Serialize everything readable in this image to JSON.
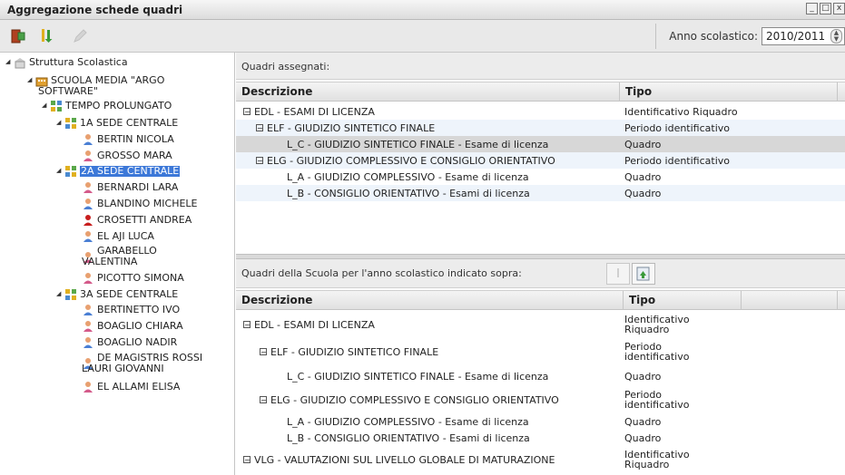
{
  "window": {
    "title": "Aggregazione schede quadri"
  },
  "toolbar": {
    "buttons": [
      {
        "name": "exit-icon"
      },
      {
        "name": "sort-icon"
      },
      {
        "name": "edit-icon"
      }
    ],
    "anno_label": "Anno scolastico:",
    "anno_value": "2010/2011"
  },
  "tree": {
    "root": "Struttura Scolastica",
    "school_line1": "SCUOLA MEDIA \"ARGO",
    "school_line2": "SOFTWARE\"",
    "tempo": "TEMPO PROLUNGATO",
    "class_1a": "1A SEDE CENTRALE",
    "s_1a": [
      "BERTIN NICOLA",
      "GROSSO MARA"
    ],
    "class_2a": "2A SEDE CENTRALE",
    "s_2a": [
      "BERNARDI LARA",
      "BLANDINO MICHELE",
      "CROSETTI ANDREA",
      "EL AJI LUCA"
    ],
    "s_2a_garabello_1": "GARABELLO",
    "s_2a_garabello_2": "VALENTINA",
    "s_2a_last": "PICOTTO SIMONA",
    "class_3a": "3A SEDE CENTRALE",
    "s_3a": [
      "BERTINETTO IVO",
      "BOAGLIO CHIARA",
      "BOAGLIO NADIR"
    ],
    "s_3a_dm_1": "DE MAGISTRIS ROSSI",
    "s_3a_dm_2": "LAURI GIOVANNI",
    "s_3a_last": "EL ALLAMI ELISA"
  },
  "assigned": {
    "title": "Quadri assegnati:",
    "col_desc": "Descrizione",
    "col_tipo": "Tipo",
    "rows": [
      {
        "desc": "EDL - ESAMI DI LICENZA",
        "tipo": "Identificativo Riquadro"
      },
      {
        "desc": "ELF - GIUDIZIO SINTETICO FINALE",
        "tipo": "Periodo identificativo"
      },
      {
        "desc": "L_C - GIUDIZIO SINTETICO FINALE - Esame di licenza",
        "tipo": "Quadro"
      },
      {
        "desc": "ELG - GIUDIZIO COMPLESSIVO E CONSIGLIO ORIENTATIVO",
        "tipo": "Periodo identificativo"
      },
      {
        "desc": "L_A - GIUDIZIO COMPLESSIVO - Esame di licenza",
        "tipo": "Quadro"
      },
      {
        "desc": "L_B - CONSIGLIO ORIENTATIVO - Esami di licenza",
        "tipo": "Quadro"
      }
    ]
  },
  "school": {
    "title": "Quadri della Scuola per l'anno scolastico indicato sopra:",
    "col_desc": "Descrizione",
    "col_tipo": "Tipo",
    "rows": [
      {
        "desc": "EDL - ESAMI DI LICENZA",
        "tipo1": "Identificativo",
        "tipo2": "Riquadro"
      },
      {
        "desc": "ELF - GIUDIZIO SINTETICO FINALE",
        "tipo1": "Periodo",
        "tipo2": "identificativo"
      },
      {
        "desc": "L_C - GIUDIZIO SINTETICO FINALE - Esame di licenza",
        "tipo1": "Quadro",
        "tipo2": ""
      },
      {
        "desc": "ELG - GIUDIZIO COMPLESSIVO E CONSIGLIO ORIENTATIVO",
        "tipo1": "Periodo",
        "tipo2": "identificativo"
      },
      {
        "desc": "L_A - GIUDIZIO COMPLESSIVO - Esame di licenza",
        "tipo1": "Quadro",
        "tipo2": ""
      },
      {
        "desc": "L_B - CONSIGLIO ORIENTATIVO - Esami di licenza",
        "tipo1": "Quadro",
        "tipo2": ""
      },
      {
        "desc": "VLG - VALUTAZIONI SUL LIVELLO GLOBALE DI MATURAZIONE",
        "tipo1": "Identificativo",
        "tipo2": "Riquadro"
      }
    ]
  },
  "colors": {
    "selection": "#3c78d8",
    "highlight_row": "#d7d7d7",
    "alt_row": "#eef4fb"
  }
}
